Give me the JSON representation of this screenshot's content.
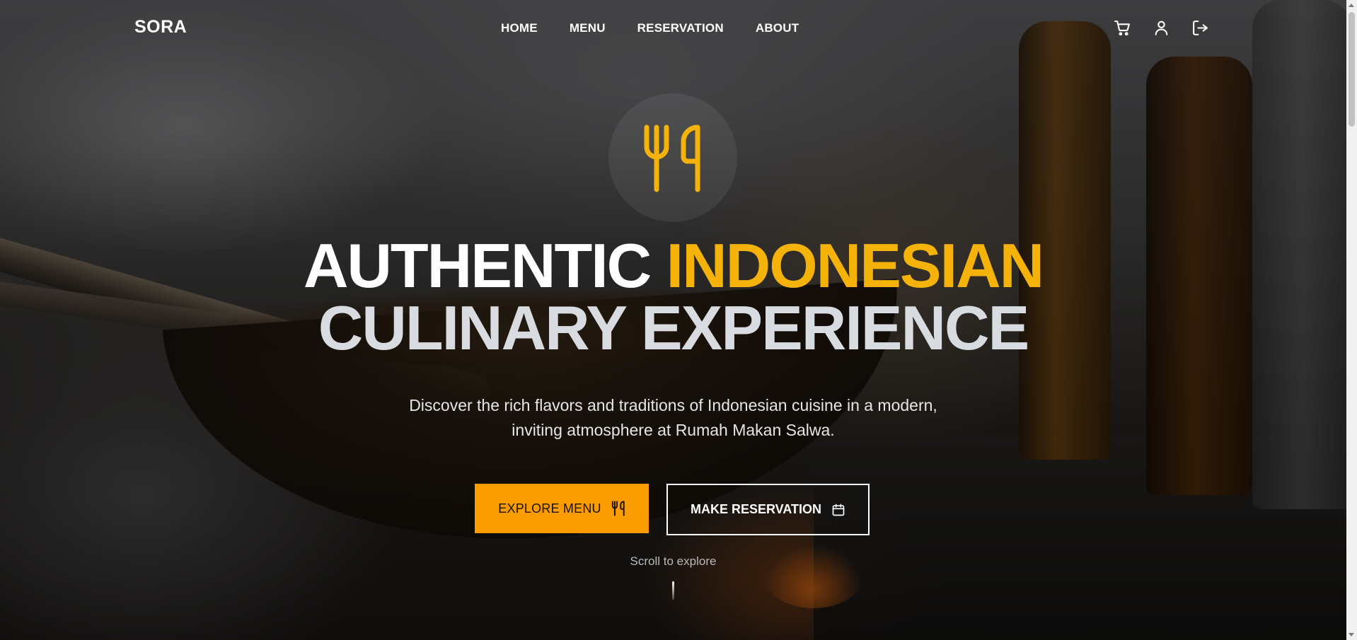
{
  "brand": {
    "name": "SORA"
  },
  "nav": {
    "links": [
      {
        "label": "HOME"
      },
      {
        "label": "MENU"
      },
      {
        "label": "RESERVATION"
      },
      {
        "label": "ABOUT"
      }
    ],
    "icons": [
      "cart-icon",
      "user-icon",
      "logout-icon"
    ]
  },
  "hero": {
    "emblem_icon": "utensils-icon",
    "headline": {
      "part1": "AUTHENTIC ",
      "accent": "INDONESIAN",
      "line2": "CULINARY EXPERIENCE"
    },
    "subtitle": {
      "line1": "Discover the rich flavors and traditions of Indonesian cuisine in a modern,",
      "line2": "inviting atmosphere at Rumah Makan Salwa."
    },
    "buttons": {
      "explore": {
        "label": "EXPLORE MENU",
        "icon": "utensils-icon"
      },
      "reserve": {
        "label": "MAKE RESERVATION",
        "icon": "calendar-icon"
      }
    },
    "scroll_hint": "Scroll to explore"
  },
  "colors": {
    "accent": "#f5b30a",
    "button_primary": "#fb9c00",
    "text_light": "#ffffff"
  }
}
